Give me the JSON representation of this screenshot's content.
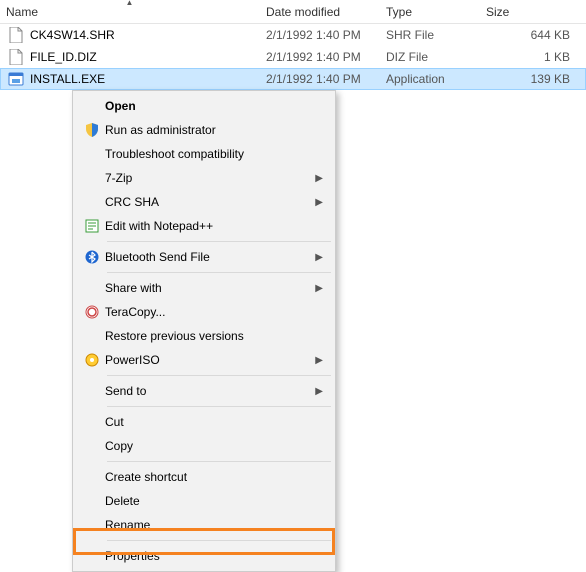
{
  "columns": {
    "name": "Name",
    "date": "Date modified",
    "type": "Type",
    "size": "Size"
  },
  "files": [
    {
      "name": "CK4SW14.SHR",
      "date": "2/1/1992 1:40 PM",
      "type": "SHR File",
      "size": "644 KB",
      "icon": "generic"
    },
    {
      "name": "FILE_ID.DIZ",
      "date": "2/1/1992 1:40 PM",
      "type": "DIZ File",
      "size": "1 KB",
      "icon": "generic"
    },
    {
      "name": "INSTALL.EXE",
      "date": "2/1/1992 1:40 PM",
      "type": "Application",
      "size": "139 KB",
      "icon": "exe"
    }
  ],
  "menu": {
    "open": "Open",
    "runadmin": "Run as administrator",
    "troubleshoot": "Troubleshoot compatibility",
    "sevenzip": "7-Zip",
    "crcsha": "CRC SHA",
    "notepadpp": "Edit with Notepad++",
    "bluetooth": "Bluetooth Send File",
    "sharewith": "Share with",
    "teracopy": "TeraCopy...",
    "restoreprev": "Restore previous versions",
    "poweriso": "PowerISO",
    "sendto": "Send to",
    "cut": "Cut",
    "copy": "Copy",
    "createshortcut": "Create shortcut",
    "delete": "Delete",
    "rename": "Rename",
    "properties": "Properties"
  }
}
